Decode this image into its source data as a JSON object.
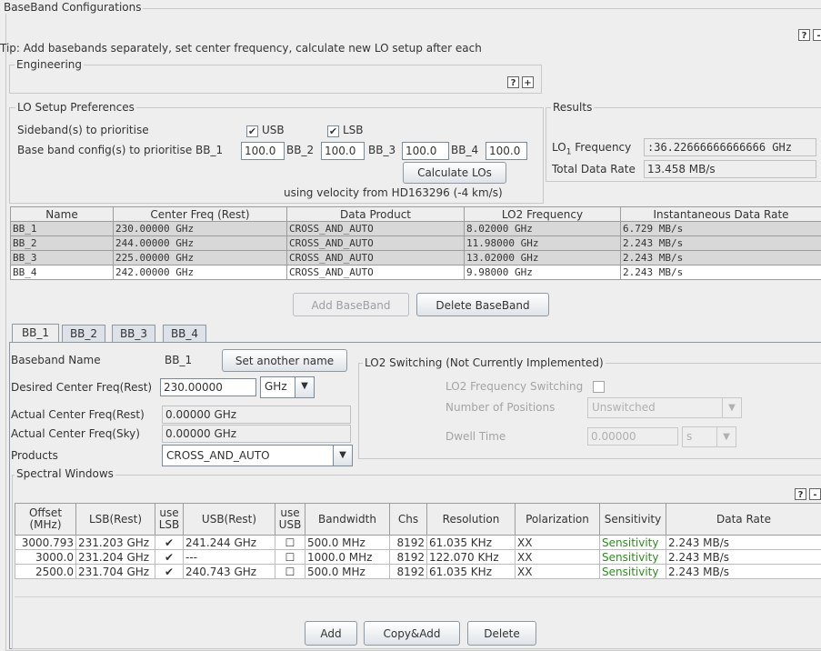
{
  "main": {
    "title": "BaseBand Configurations",
    "tip": "Tip: Add basebands separately, set center frequency, calculate new LO setup after each",
    "help": "?",
    "collapse": "-",
    "expand": "+",
    "engineering_title": "Engineering"
  },
  "lo_prefs": {
    "title": "LO Setup Preferences",
    "sideband_label": "Sideband(s) to prioritise",
    "usb_label": "USB",
    "lsb_label": "LSB",
    "usb_checked": true,
    "lsb_checked": true,
    "bb_config_label": "Base band config(s) to prioritise BB_1",
    "bb1_value": "100.0",
    "bb2_label": "BB_2",
    "bb2_value": "100.0",
    "bb3_label": "BB_3",
    "bb3_value": "100.0",
    "bb4_label": "BB_4",
    "bb4_value": "100.0",
    "calculate_label": "Calculate LOs",
    "velocity_note": "using velocity from HD163296 (-4 km/s)"
  },
  "results": {
    "title": "Results",
    "lo1_label_main": "LO",
    "lo1_label_sub": "1",
    "lo1_label_rest": " Frequency",
    "lo1_value": ":36.22666666666666 GHz",
    "rate_label": "Total Data Rate",
    "rate_value": "13.458 MB/s"
  },
  "baseband_table": {
    "columns": [
      "Name",
      "Center Freq (Rest)",
      "Data Product",
      "LO2 Frequency",
      "Instantaneous Data Rate"
    ],
    "rows": [
      [
        "BB_1",
        "230.00000 GHz",
        "CROSS_AND_AUTO",
        "8.02000 GHz",
        "6.729 MB/s"
      ],
      [
        "BB_2",
        "244.00000 GHz",
        "CROSS_AND_AUTO",
        "11.98000 GHz",
        "2.243 MB/s"
      ],
      [
        "BB_3",
        "225.00000 GHz",
        "CROSS_AND_AUTO",
        "13.02000 GHz",
        "2.243 MB/s"
      ],
      [
        "BB_4",
        "242.00000 GHz",
        "CROSS_AND_AUTO",
        "9.98000 GHz",
        "2.243 MB/s"
      ]
    ]
  },
  "bb_buttons": {
    "add": "Add BaseBand",
    "delete": "Delete BaseBand"
  },
  "tabs": [
    "BB_1",
    "BB_2",
    "BB_3",
    "BB_4"
  ],
  "bb_form": {
    "name_label": "Baseband Name",
    "name_value": "BB_1",
    "rename_label": "Set another name",
    "desired_label": "Desired Center Freq(Rest)",
    "desired_value": "230.00000",
    "desired_unit": "GHz",
    "actual_rest_label": "Actual Center Freq(Rest)",
    "actual_rest_value": "0.00000 GHz",
    "actual_sky_label": "Actual Center Freq(Sky)",
    "actual_sky_value": "0.00000 GHz",
    "products_label": "Products",
    "products_value": "CROSS_AND_AUTO"
  },
  "lo2": {
    "title": "LO2 Switching (Not Currently Implemented)",
    "switching_label": "LO2 Frequency Switching",
    "positions_label": "Number of Positions",
    "positions_value": "Unswitched",
    "dwell_label": "Dwell Time",
    "dwell_value": "0.00000",
    "dwell_unit": "s"
  },
  "spectral": {
    "title": "Spectral Windows",
    "columns": [
      "Offset (MHz)",
      "LSB(Rest)",
      "use LSB",
      "USB(Rest)",
      "use USB",
      "Bandwidth",
      "Chs",
      "Resolution",
      "Polarization",
      "Sensitivity",
      "Data Rate"
    ],
    "rows": [
      {
        "offset": "3000.793",
        "lsb": "231.203 GHz",
        "use_lsb": true,
        "usb": "241.244 GHz",
        "use_usb": false,
        "bandwidth": "500.0 MHz",
        "chs": "8192",
        "resolution": "61.035  KHz",
        "pol": "XX",
        "sens": "Sensitivity",
        "rate": "2.243 MB/s"
      },
      {
        "offset": "3000.0",
        "lsb": "231.204 GHz",
        "use_lsb": true,
        "usb": "---",
        "use_usb": false,
        "bandwidth": "1000.0 MHz",
        "chs": "8192",
        "resolution": "122.070  KHz",
        "pol": "XX",
        "sens": "Sensitivity",
        "rate": "2.243 MB/s"
      },
      {
        "offset": "2500.0",
        "lsb": "231.704 GHz",
        "use_lsb": true,
        "usb": "240.743 GHz",
        "use_usb": false,
        "bandwidth": "500.0 MHz",
        "chs": "8192",
        "resolution": "61.035  KHz",
        "pol": "XX",
        "sens": "Sensitivity",
        "rate": "2.243 MB/s"
      }
    ],
    "add": "Add",
    "copy_add": "Copy&Add",
    "delete": "Delete"
  },
  "colors": {
    "accent": "#2e8b1f",
    "selected_row": "#d8d8d8"
  }
}
